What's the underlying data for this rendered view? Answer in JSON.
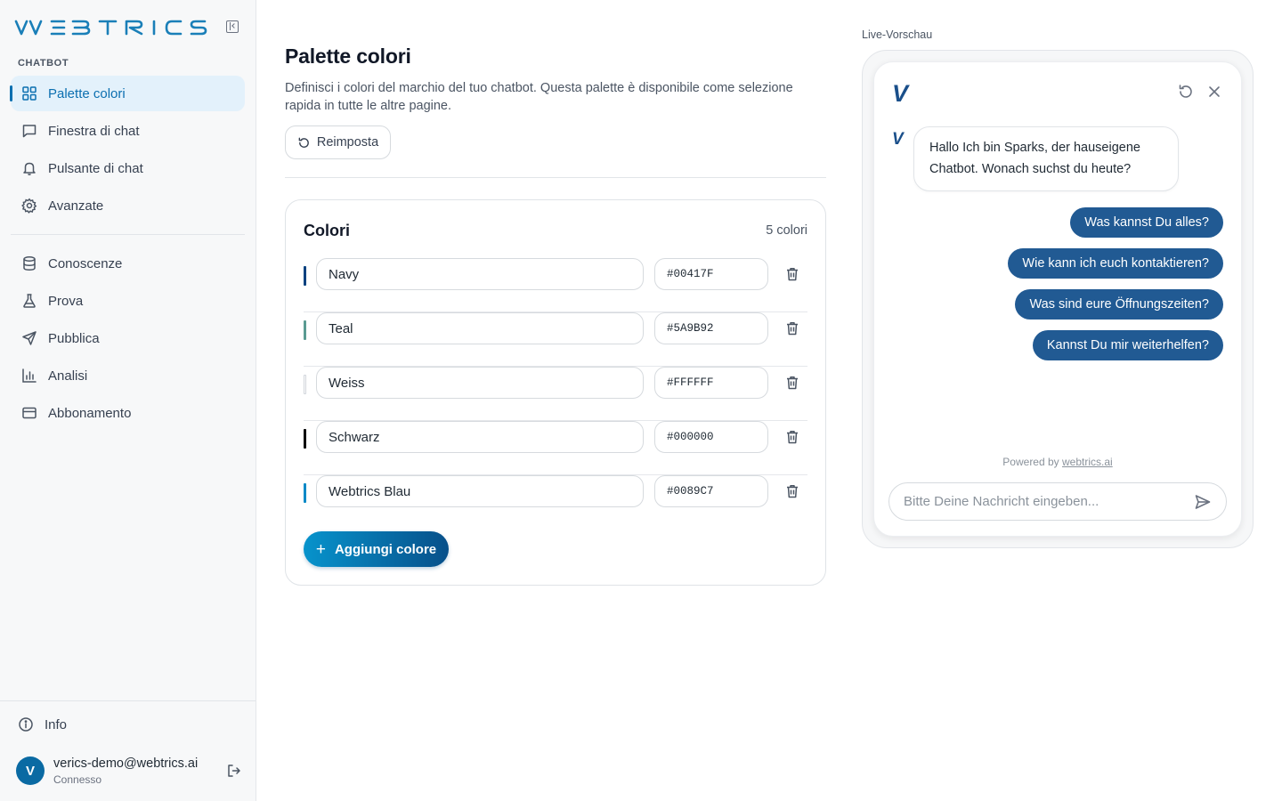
{
  "brand": {
    "logo_text": "WEBRICS"
  },
  "sidebar": {
    "section_label": "CHATBOT",
    "items": [
      {
        "label": "Palette colori",
        "icon": "grid-icon",
        "active": true
      },
      {
        "label": "Finestra di chat",
        "icon": "chat-bubble-icon"
      },
      {
        "label": "Pulsante di chat",
        "icon": "bell-icon"
      },
      {
        "label": "Avanzate",
        "icon": "gear-icon"
      },
      {
        "label": "Conoscenze",
        "icon": "database-icon"
      },
      {
        "label": "Prova",
        "icon": "flask-icon"
      },
      {
        "label": "Pubblica",
        "icon": "send-icon"
      },
      {
        "label": "Analisi",
        "icon": "bar-chart-icon"
      },
      {
        "label": "Abbonamento",
        "icon": "credit-card-icon"
      }
    ],
    "info_label": "Info",
    "user": {
      "initial": "V",
      "email": "verics-demo@webtrics.ai",
      "status": "Connesso"
    }
  },
  "main": {
    "title": "Palette colori",
    "description": "Definisci i colori del marchio del tuo chatbot. Questa palette è disponibile come selezione rapida in tutte le altre pagine.",
    "reset_label": "Reimposta",
    "card": {
      "title": "Colori",
      "count": "5 colori",
      "colors": [
        {
          "name": "Navy",
          "hex": "#00417F"
        },
        {
          "name": "Teal",
          "hex": "#5A9B92"
        },
        {
          "name": "Weiss",
          "hex": "#FFFFFF"
        },
        {
          "name": "Schwarz",
          "hex": "#000000"
        },
        {
          "name": "Webtrics Blau",
          "hex": "#0089C7"
        }
      ],
      "add_label": "Aggiungi colore"
    }
  },
  "preview": {
    "label": "Live-Vorschau",
    "bot_logo": "V",
    "greeting": "Hallo Ich bin Sparks, der hauseigene Chatbot. Wonach suchst du heute?",
    "suggestions": [
      "Was kannst Du alles?",
      "Wie kann ich euch kontaktieren?",
      "Was sind eure Öffnungszeiten?",
      "Kannst Du mir weiterhelfen?"
    ],
    "powered_prefix": "Powered by ",
    "powered_link": "webtrics.ai",
    "input_placeholder": "Bitte Deine Nachricht eingeben..."
  },
  "colors": {
    "accent": "#0b6fb0",
    "suggestion_bg": "#215a93",
    "active_bg": "#e3f1fb"
  }
}
